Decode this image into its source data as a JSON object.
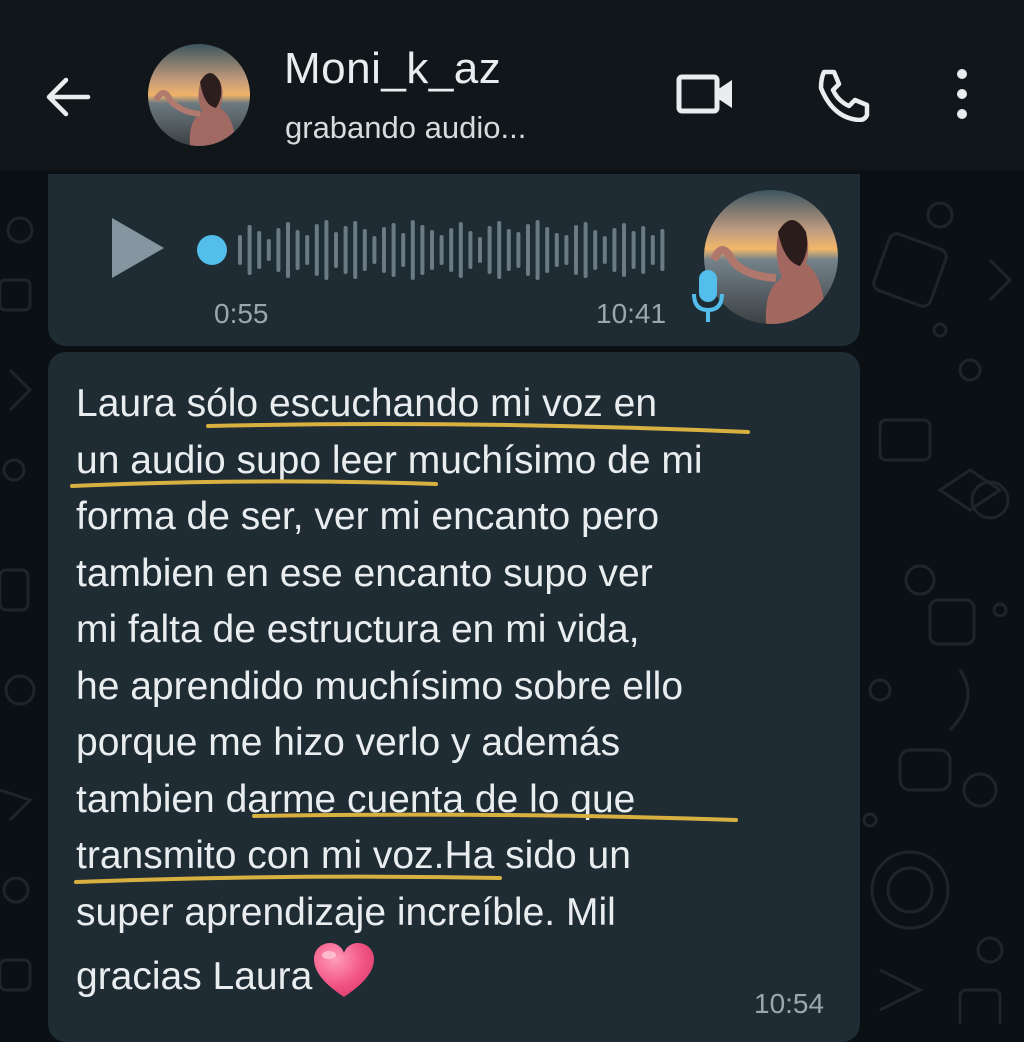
{
  "header": {
    "contact_name": "Moni_k_az",
    "status": "grabando audio..."
  },
  "voice_message": {
    "duration": "0:55",
    "time": "10:41",
    "progress": 0
  },
  "text_message": {
    "lines": [
      "Laura sólo escuchando mi voz en",
      "un audio supo leer muchísimo de mi",
      "forma de ser, ver mi encanto pero",
      "tambien en ese encanto supo ver",
      "mi falta de estructura en mi vida,",
      "he aprendido muchísimo sobre ello",
      "porque me hizo verlo y además",
      "tambien darme cuenta de lo que",
      "transmito con mi voz.Ha sido un",
      "super aprendizaje increíble. Mil",
      "gracias Laura"
    ],
    "emoji": "pink-heart",
    "time": "10:54"
  },
  "icons": {
    "back": "arrow-left-icon",
    "video": "video-call-icon",
    "call": "phone-icon",
    "menu": "more-vert-icon",
    "play": "play-icon",
    "mic": "microphone-icon"
  },
  "colors": {
    "header_bg": "#101619",
    "bubble_bg": "#1f2c33",
    "wallpaper_bg": "#0b1014",
    "voice_accent": "#53bdeb",
    "underline": "#d8b040",
    "heart": "#f25584"
  }
}
